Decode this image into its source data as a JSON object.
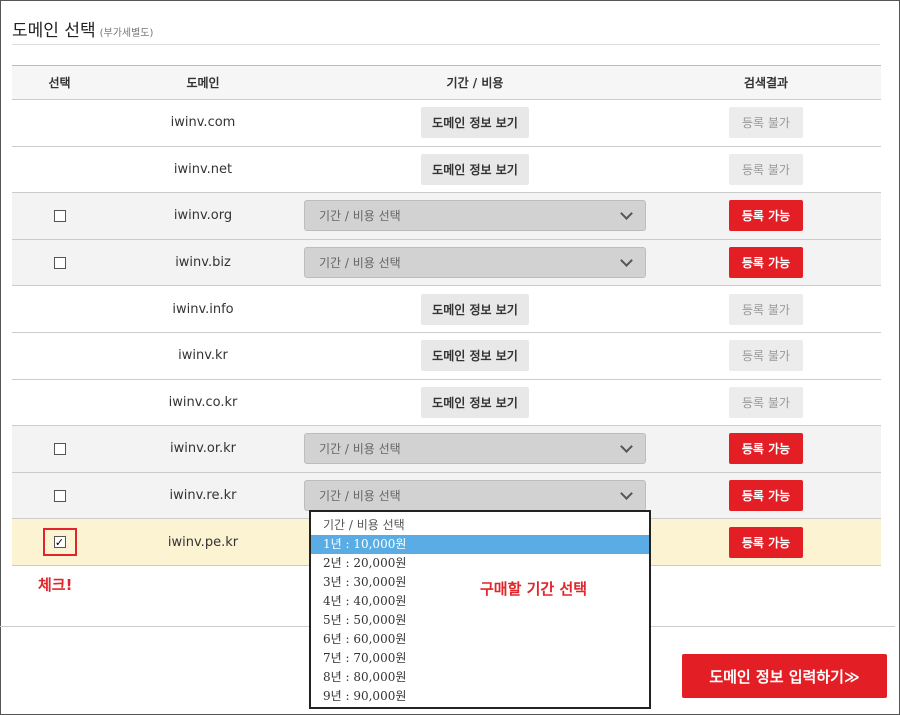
{
  "header": {
    "title": "도메인 선택",
    "subtitle": "(부가세별도)"
  },
  "table": {
    "columns": [
      "선택",
      "도메인",
      "기간 / 비용",
      "검색결과"
    ],
    "rows": [
      {
        "domain": "iwinv.com",
        "type": "info",
        "info_label": "도메인 정보 보기",
        "result": "등록 불가"
      },
      {
        "domain": "iwinv.net",
        "type": "info",
        "info_label": "도메인 정보 보기",
        "result": "등록 불가"
      },
      {
        "domain": "iwinv.org",
        "type": "select",
        "select_label": "기간 / 비용 선택",
        "result": "등록 가능"
      },
      {
        "domain": "iwinv.biz",
        "type": "select",
        "select_label": "기간 / 비용 선택",
        "result": "등록 가능"
      },
      {
        "domain": "iwinv.info",
        "type": "info",
        "info_label": "도메인 정보 보기",
        "result": "등록 불가"
      },
      {
        "domain": "iwinv.kr",
        "type": "info",
        "info_label": "도메인 정보 보기",
        "result": "등록 불가"
      },
      {
        "domain": "iwinv.co.kr",
        "type": "info",
        "info_label": "도메인 정보 보기",
        "result": "등록 불가"
      },
      {
        "domain": "iwinv.or.kr",
        "type": "select",
        "select_label": "기간 / 비용 선택",
        "result": "등록 가능"
      },
      {
        "domain": "iwinv.re.kr",
        "type": "select",
        "select_label": "기간 / 비용 선택",
        "result": "등록 가능"
      },
      {
        "domain": "iwinv.pe.kr",
        "type": "checked",
        "check_mark": "✓",
        "result": "등록 가능"
      }
    ]
  },
  "dropdown": {
    "options": [
      "기간 / 비용 선택",
      "1년 : 10,000원",
      "2년 : 20,000원",
      "3년 : 30,000원",
      "4년 : 40,000원",
      "5년 : 50,000원",
      "6년 : 60,000원",
      "7년 : 70,000원",
      "8년 : 80,000원",
      "9년 : 90,000원"
    ],
    "selected_index": 1
  },
  "annotations": {
    "check": "체크!",
    "period": "구매할 기간 선택"
  },
  "submit_label": "도메인 정보 입력하기≫",
  "colors": {
    "accent": "#e31e25",
    "highlight_row": "#fbf3d2",
    "selected_option": "#5aade4"
  }
}
